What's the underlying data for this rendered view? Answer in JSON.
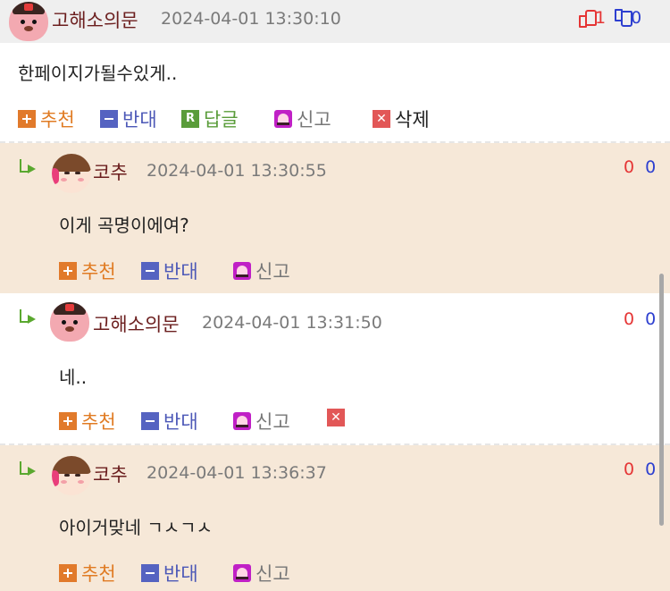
{
  "top_comment": {
    "author": "고해소의문",
    "date": "2024-04-01 13:30:10",
    "upvotes": "1",
    "downvotes": "0",
    "text": "한페이지가될수있게..",
    "actions": {
      "recommend": "추천",
      "oppose": "반대",
      "reply": "답글",
      "report": "신고",
      "delete": "삭제"
    }
  },
  "replies": [
    {
      "author": "코추",
      "date": "2024-04-01 13:30:55",
      "upvotes": "0",
      "downvotes": "0",
      "text": "이게 곡명이에여?",
      "actions": {
        "recommend": "추천",
        "oppose": "반대",
        "report": "신고"
      }
    },
    {
      "author": "고해소의문",
      "date": "2024-04-01 13:31:50",
      "upvotes": "0",
      "downvotes": "0",
      "text": "네..",
      "actions": {
        "recommend": "추천",
        "oppose": "반대",
        "report": "신고"
      }
    },
    {
      "author": "코추",
      "date": "2024-04-01 13:36:37",
      "upvotes": "0",
      "downvotes": "0",
      "text": "아이거맞네 ㄱㅅㄱㅅ",
      "actions": {
        "recommend": "추천",
        "oppose": "반대",
        "report": "신고"
      }
    }
  ],
  "colors": {
    "recommend": "#e07b23",
    "oppose": "#4c58b7",
    "reply": "#5a9c3a",
    "upvote": "#e53535",
    "downvote": "#2d3fd0",
    "reply_bg": "#f6e8d8",
    "nick": "#6b1e1e"
  },
  "icons": [
    "beaver-avatar",
    "girl-avatar",
    "thumb-up-icon",
    "thumb-down-icon",
    "plus-icon",
    "minus-icon",
    "reply-r-icon",
    "bell-icon",
    "delete-x-icon",
    "reply-arrow-icon"
  ]
}
